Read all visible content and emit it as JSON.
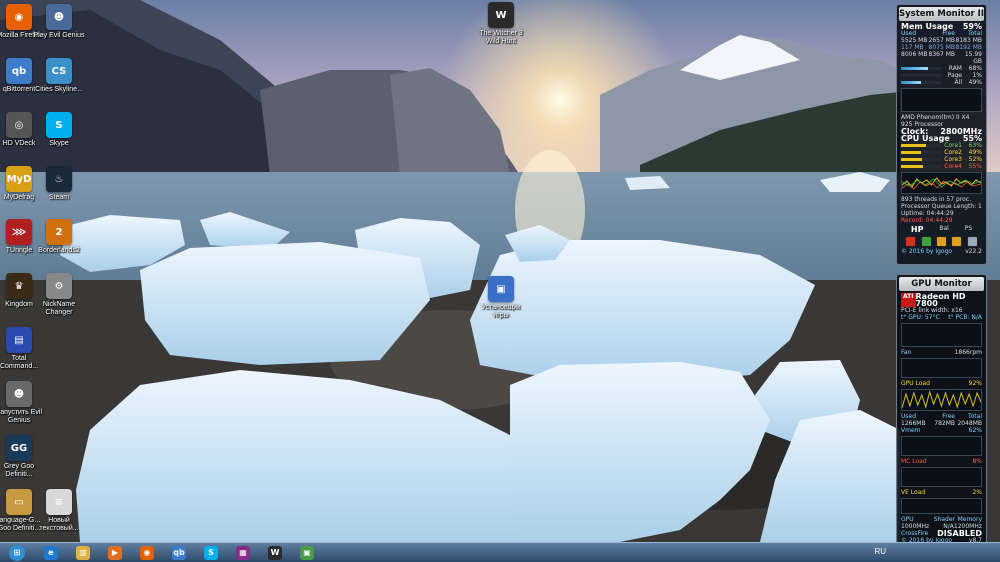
{
  "desktop": {
    "icons": [
      {
        "label": "Mozilla Firefox",
        "icon": "firefox-icon",
        "glyph": "◉",
        "color": "#e66000"
      },
      {
        "label": "Play Evil Genius",
        "icon": "evil-genius-icon",
        "glyph": "☻",
        "color": "#4a6a9a"
      },
      {
        "label": "qBittorrent",
        "icon": "qbittorrent-icon",
        "glyph": "qb",
        "color": "#3d7cc9"
      },
      {
        "label": "Cities Skyline...",
        "icon": "cities-skylines-icon",
        "glyph": "CS",
        "color": "#3a90c8"
      },
      {
        "label": "HD VDeck",
        "icon": "hd-vdeck-icon",
        "glyph": "◎",
        "color": "#555"
      },
      {
        "label": "Skype",
        "icon": "skype-icon",
        "glyph": "S",
        "color": "#00aff0"
      },
      {
        "label": "MyDefrag",
        "icon": "mydefrag-icon",
        "glyph": "MyD",
        "color": "#d8a010"
      },
      {
        "label": "Steam",
        "icon": "steam-icon",
        "glyph": "♨",
        "color": "#1b2838"
      },
      {
        "label": "TUnngle",
        "icon": "tunngle-icon",
        "glyph": "⋙",
        "color": "#b02020"
      },
      {
        "label": "Borderlands2",
        "icon": "borderlands2-icon",
        "glyph": "2",
        "color": "#d07010"
      },
      {
        "label": "Kingdom",
        "icon": "kingdom-icon",
        "glyph": "♛",
        "color": "#3a2a18"
      },
      {
        "label": "NickName Changer",
        "icon": "nickname-changer-icon",
        "glyph": "⚙",
        "color": "#888"
      },
      {
        "label": "Total Command...",
        "icon": "total-commander-icon",
        "glyph": "▤",
        "color": "#2a4ab0"
      },
      {
        "label": "Запустить Evil Genius",
        "icon": "evil-genius-launch-icon",
        "glyph": "☻",
        "color": "#6a6a6a"
      },
      {
        "label": "Grey Goo Definiti...",
        "icon": "grey-goo-icon",
        "glyph": "GG",
        "color": "#1a3a5a"
      },
      {
        "label": "language-G... Goo Definiti...",
        "icon": "language-file-icon",
        "glyph": "▭",
        "color": "#c89a40"
      },
      {
        "label": "Новый текстовый...",
        "icon": "text-document-icon",
        "glyph": "≡",
        "color": "#d8d8d8"
      },
      {
        "label": "The Witcher 3 Wild Hunt",
        "icon": "witcher-icon",
        "glyph": "W",
        "color": "#2a2a2a"
      },
      {
        "label": "Установщик игры",
        "icon": "installer-icon",
        "glyph": "▣",
        "color": "#3a70c8"
      }
    ]
  },
  "system_monitor": {
    "title": "System Monitor II",
    "mem_label": "Mem Usage",
    "mem_pct": "59%",
    "mem_headers": [
      "Used",
      "Free",
      "Total"
    ],
    "mem_rows": [
      [
        "5525 MB",
        "2657 MB",
        "8183 MB"
      ],
      [
        "117 MB",
        "8075 MB",
        "8192 MB"
      ],
      [
        "8006 MB",
        "8367 MB",
        "15.99 GB"
      ]
    ],
    "ram_rows": [
      [
        "RAM",
        "68%"
      ],
      [
        "Page",
        "1%"
      ],
      [
        "All",
        "49%"
      ]
    ],
    "cpu_name": "AMD Phenom(tm) II X4 925 Processor",
    "clock_label": "Clock:",
    "clock_val": "2800MHz",
    "cpu_label": "CPU Usage",
    "cpu_pct": "55%",
    "cores": [
      [
        "Core1",
        "63%"
      ],
      [
        "Core2",
        "49%"
      ],
      [
        "Core3",
        "52%"
      ],
      [
        "Core4",
        "55%"
      ]
    ],
    "threads_line": "893 threads in 57 proc.",
    "queue_line": "Processor Queue Length: 1",
    "uptime_line": "Uptime: 04:44:29",
    "record_line": "Record: 04:44:29",
    "btn_labels": [
      "HP",
      "Bal",
      "PS"
    ],
    "version": "v22.2",
    "credit": "© 2016 by Igogo"
  },
  "gpu_monitor": {
    "title": "GPU Monitor",
    "gpu_name": "Radeon HD 7800",
    "pcie": "PCI-E link width: x16",
    "temp_gpu": "t° GPU: 57°C",
    "temp_pcb": "t° PCB: N/A",
    "fan_label": "Fan",
    "fan_val": "1866rpm",
    "load_label": "GPU Load",
    "load_val": "92%",
    "vram_headers": [
      "Used",
      "Free",
      "Total"
    ],
    "vram_vals": [
      "1266MB",
      "782MB",
      "2048MB"
    ],
    "vmem_label": "Vmem",
    "vmem_val": "62%",
    "mc_label": "MC Load",
    "mc_val": "8%",
    "ve_label": "VE Load",
    "ve_val": "2%",
    "clock_headers": [
      "GPU",
      "Shader",
      "Memory"
    ],
    "clock_vals": [
      "1000MHz",
      "N/A",
      "1200MHz"
    ],
    "crossfire_label": "CrossFire",
    "crossfire_val": "DISABLED",
    "credit": "© 2016 by Igogo",
    "version": "v8.7"
  },
  "taskbar": {
    "lang": "RU",
    "items": [
      {
        "icon": "start-orb-icon",
        "glyph": "⊞",
        "color": "#2f8fd0"
      },
      {
        "icon": "internet-explorer-icon",
        "glyph": "e",
        "color": "#1e7ad0"
      },
      {
        "icon": "file-explorer-icon",
        "glyph": "▥",
        "color": "#e0b040"
      },
      {
        "icon": "media-player-icon",
        "glyph": "▶",
        "color": "#e07020"
      },
      {
        "icon": "firefox-icon",
        "glyph": "◉",
        "color": "#e66000"
      },
      {
        "icon": "qbittorrent-icon",
        "glyph": "qb",
        "color": "#3d7cc9"
      },
      {
        "icon": "skype-icon",
        "glyph": "S",
        "color": "#00aff0"
      },
      {
        "icon": "winrar-icon",
        "glyph": "▦",
        "color": "#8a2a8a"
      },
      {
        "icon": "witcher-icon",
        "glyph": "W",
        "color": "#2a2a2a"
      },
      {
        "icon": "installer-icon",
        "glyph": "▣",
        "color": "#4a9a4a"
      }
    ]
  }
}
